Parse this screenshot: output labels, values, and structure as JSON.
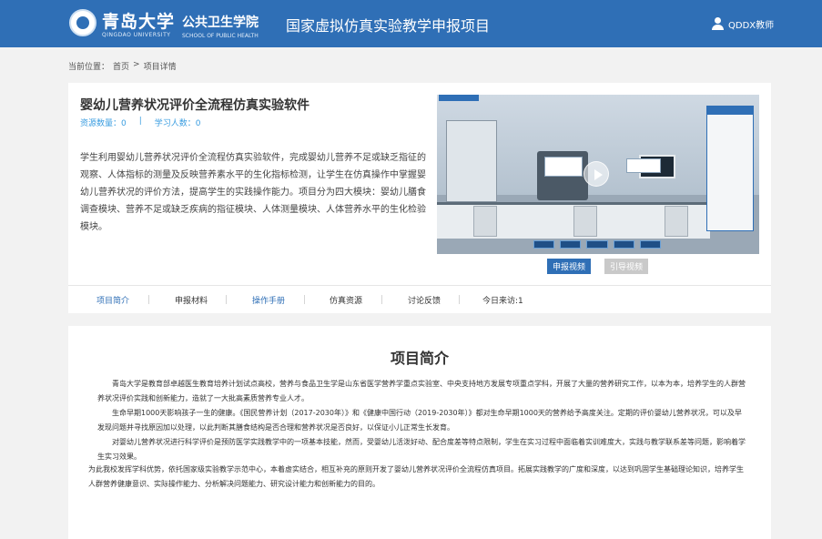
{
  "header": {
    "logo_cn": "青岛大学",
    "logo_en": "QINGDAO UNIVERSITY",
    "school_cn": "公共卫生学院",
    "school_en": "SCHOOL OF PUBLIC HEALTH",
    "project_title": "国家虚拟仿真实验教学申报项目",
    "user_name": "QDDX教师"
  },
  "breadcrumb": {
    "prefix": "当前位置：",
    "home": "首页",
    "separator": ">",
    "current": "项目详情"
  },
  "project": {
    "title": "婴幼儿营养状况评价全流程仿真实验软件",
    "resource_count": "资源数量：0",
    "separator": "|",
    "learner_count": "学习人数：0",
    "description": "学生利用婴幼儿营养状况评价全流程仿真实验软件，完成婴幼儿营养不足或缺乏指征的观察、人体指标的测量及反映营养素水平的生化指标检测，让学生在仿真操作中掌握婴幼儿营养状况的评价方法，提高学生的实践操作能力。项目分为四大模块：婴幼儿膳食调查模块、营养不足或缺乏疾病的指征模块、人体测量模块、人体营养水平的生化检验模块。"
  },
  "buttons": {
    "apply_video": "申报视频",
    "guide_video": "引导视频"
  },
  "tabs": [
    {
      "label": "项目简介"
    },
    {
      "label": "申报材料"
    },
    {
      "label": "操作手册"
    },
    {
      "label": "仿真资源"
    },
    {
      "label": "讨论反馈"
    },
    {
      "label": "今日来访:1"
    }
  ],
  "intro": {
    "title": "项目简介",
    "p1": "青岛大学是教育部卓越医生教育培养计划试点高校，营养与食品卫生学是山东省医学营养学重点实验室、中央支持地方发展专项重点学科，开展了大量的营养研究工作，以本为本，培养学生的人群营养状况评价实践和创新能力，造就了一大批高素质营养专业人才。",
    "p2": "生命早期1000天影响孩子一生的健康。《国民营养计划（2017-2030年）》和《健康中国行动（2019-2030年）》都对生命早期1000天的营养给予高度关注。定期的评价婴幼儿营养状况，可以及早发现问题并寻找原因加以处理，以此判断其膳食结构是否合理和营养状况是否良好，以保证小儿正常生长发育。",
    "p3": "对婴幼儿营养状况进行科学评价是预防医学实践教学中的一项基本技能，然而，受婴幼儿活泼好动、配合度差等特点限制，学生在实习过程中面临着实训难度大，实践与教学联系差等问题，影响着学生实习效果。",
    "p4": "为此我校发挥学科优势，依托国家级实验教学示范中心，本着虚实结合，相互补充的原则开发了婴幼儿营养状况评价全流程仿真项目。拓展实践教学的广度和深度，以达到巩固学生基础理论知识，培养学生人群营养健康意识、实际操作能力、分析解决问题能力、研究设计能力和创新能力的目的。"
  }
}
